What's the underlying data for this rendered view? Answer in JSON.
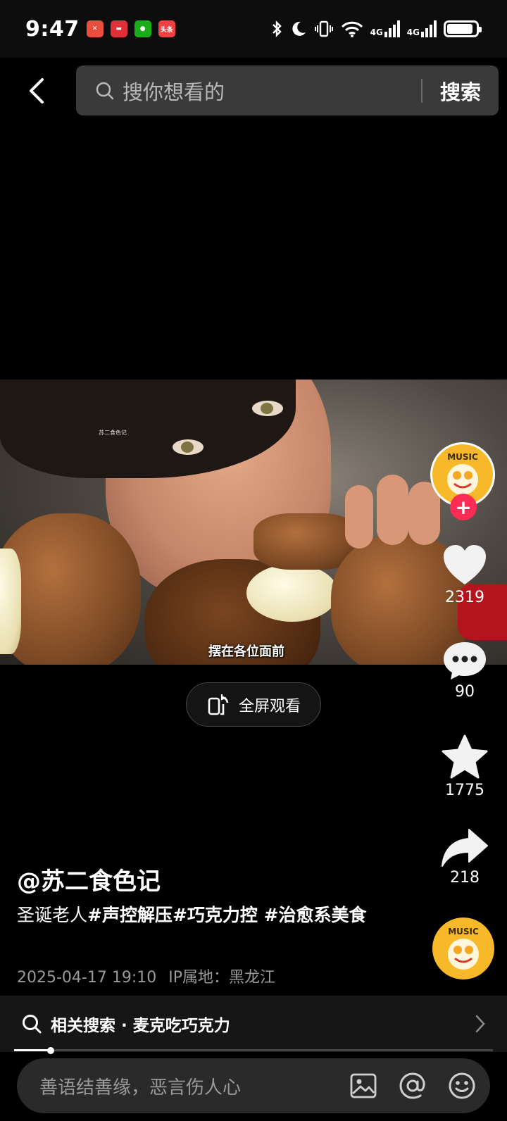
{
  "status_bar": {
    "time": "9:47",
    "notifications": [
      {
        "icon": "red-app-icon",
        "color": "#e94d3c",
        "glyph": "✕"
      },
      {
        "icon": "huawei-store-icon",
        "color": "#e0303a",
        "glyph": "▬"
      },
      {
        "icon": "wechat-icon",
        "color": "#1aad19",
        "glyph": "●"
      },
      {
        "icon": "toutiao-icon",
        "color": "#f04142",
        "glyph": "头条"
      }
    ],
    "network_labels": [
      "4G",
      "4G"
    ],
    "battery_level": 0.9
  },
  "header": {
    "back_icon": "chevron-left-icon",
    "search_placeholder": "搜你想看的",
    "search_button": "搜索"
  },
  "video": {
    "watermark": "苏二食色记",
    "caption": "摆在各位面前",
    "fullscreen_label": "全屏观看"
  },
  "right_rail": {
    "avatar_text": "MUSIC",
    "follow_label": "+",
    "likes": "2319",
    "comments": "90",
    "favorites": "1775",
    "shares": "218"
  },
  "post": {
    "author": "@苏二食色记",
    "description_plain": "圣诞老人",
    "description_tags": "#声控解压#巧克力控 #治愈系美食",
    "date": "2025-04-17 19:10",
    "ip_location": "IP属地：黑龙江"
  },
  "related_search": {
    "label": "相关搜索 · 麦克吃巧克力"
  },
  "progress": {
    "fraction": 0.077
  },
  "comment_bar": {
    "placeholder": "善语结善缘，恶言伤人心",
    "icons": [
      "image-icon",
      "at-icon",
      "emoji-icon"
    ]
  }
}
